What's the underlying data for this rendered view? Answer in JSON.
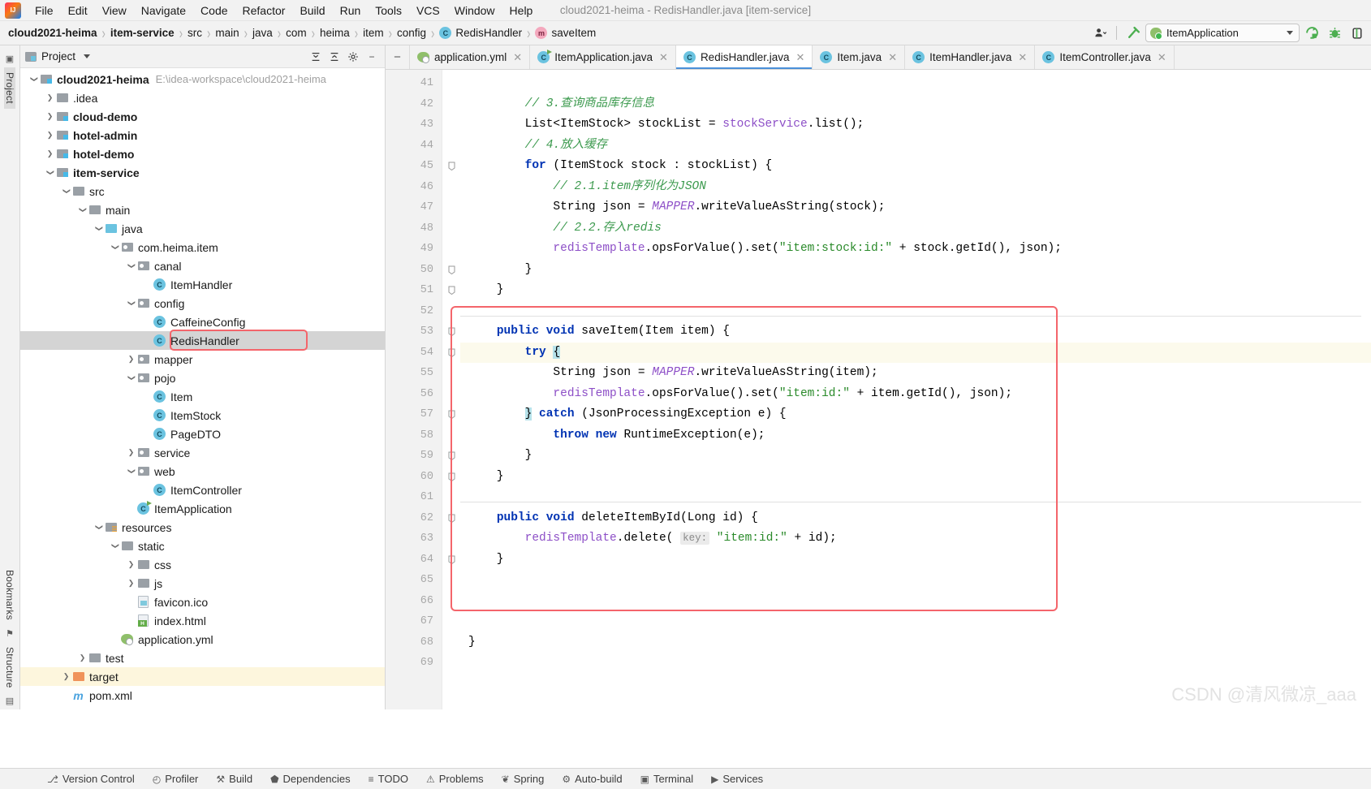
{
  "window": {
    "title": "cloud2021-heima - RedisHandler.java [item-service]"
  },
  "menubar": {
    "items": [
      {
        "label": "File"
      },
      {
        "label": "Edit"
      },
      {
        "label": "View"
      },
      {
        "label": "Navigate"
      },
      {
        "label": "Code"
      },
      {
        "label": "Refactor"
      },
      {
        "label": "Build"
      },
      {
        "label": "Run"
      },
      {
        "label": "Tools"
      },
      {
        "label": "VCS"
      },
      {
        "label": "Window"
      },
      {
        "label": "Help"
      }
    ]
  },
  "breadcrumb": {
    "items": [
      {
        "label": "cloud2021-heima",
        "bold": true
      },
      {
        "label": "item-service",
        "bold": true
      },
      {
        "label": "src"
      },
      {
        "label": "main"
      },
      {
        "label": "java"
      },
      {
        "label": "com"
      },
      {
        "label": "heima"
      },
      {
        "label": "item"
      },
      {
        "label": "config"
      },
      {
        "label": "RedisHandler",
        "badge": "C"
      },
      {
        "label": "saveItem",
        "badge": "m"
      }
    ]
  },
  "toolbar": {
    "run_config": "ItemApplication",
    "buttons": [
      "search-everywhere",
      "settings"
    ]
  },
  "rail": {
    "project_label": "Project",
    "bookmarks_label": "Bookmarks",
    "structure_label": "Structure"
  },
  "project_panel": {
    "title": "Project",
    "tree": [
      {
        "depth": 0,
        "arrow": "d",
        "icon": "f-mod",
        "label": "cloud2021-heima",
        "bold": true,
        "hint": "E:\\idea-workspace\\cloud2021-heima"
      },
      {
        "depth": 1,
        "arrow": "r",
        "icon": "f-plain",
        "label": ".idea"
      },
      {
        "depth": 1,
        "arrow": "r",
        "icon": "f-mod",
        "label": "cloud-demo",
        "bold": true
      },
      {
        "depth": 1,
        "arrow": "r",
        "icon": "f-mod",
        "label": "hotel-admin",
        "bold": true
      },
      {
        "depth": 1,
        "arrow": "r",
        "icon": "f-mod",
        "label": "hotel-demo",
        "bold": true
      },
      {
        "depth": 1,
        "arrow": "d",
        "icon": "f-mod",
        "label": "item-service",
        "bold": true
      },
      {
        "depth": 2,
        "arrow": "d",
        "icon": "f-plain",
        "label": "src"
      },
      {
        "depth": 3,
        "arrow": "d",
        "icon": "f-plain",
        "label": "main"
      },
      {
        "depth": 4,
        "arrow": "d",
        "icon": "f-src",
        "label": "java"
      },
      {
        "depth": 5,
        "arrow": "d",
        "icon": "f-pkg",
        "label": "com.heima.item"
      },
      {
        "depth": 6,
        "arrow": "d",
        "icon": "f-pkg",
        "label": "canal"
      },
      {
        "depth": 7,
        "arrow": "",
        "icon": "c-ico",
        "label": "ItemHandler"
      },
      {
        "depth": 6,
        "arrow": "d",
        "icon": "f-pkg",
        "label": "config"
      },
      {
        "depth": 7,
        "arrow": "",
        "icon": "c-ico",
        "label": "CaffeineConfig"
      },
      {
        "depth": 7,
        "arrow": "",
        "icon": "c-ico",
        "label": "RedisHandler",
        "selected": true,
        "boxed": true
      },
      {
        "depth": 6,
        "arrow": "r",
        "icon": "f-pkg",
        "label": "mapper"
      },
      {
        "depth": 6,
        "arrow": "d",
        "icon": "f-pkg",
        "label": "pojo"
      },
      {
        "depth": 7,
        "arrow": "",
        "icon": "c-ico",
        "label": "Item"
      },
      {
        "depth": 7,
        "arrow": "",
        "icon": "c-ico",
        "label": "ItemStock"
      },
      {
        "depth": 7,
        "arrow": "",
        "icon": "c-ico",
        "label": "PageDTO"
      },
      {
        "depth": 6,
        "arrow": "r",
        "icon": "f-pkg",
        "label": "service"
      },
      {
        "depth": 6,
        "arrow": "d",
        "icon": "f-pkg",
        "label": "web"
      },
      {
        "depth": 7,
        "arrow": "",
        "icon": "c-ico",
        "label": "ItemController"
      },
      {
        "depth": 6,
        "arrow": "",
        "icon": "c-boot",
        "label": "ItemApplication"
      },
      {
        "depth": 4,
        "arrow": "d",
        "icon": "f-res",
        "label": "resources"
      },
      {
        "depth": 5,
        "arrow": "d",
        "icon": "f-plain",
        "label": "static"
      },
      {
        "depth": 6,
        "arrow": "r",
        "icon": "f-plain",
        "label": "css"
      },
      {
        "depth": 6,
        "arrow": "r",
        "icon": "f-plain",
        "label": "js"
      },
      {
        "depth": 6,
        "arrow": "",
        "icon": "ico-img",
        "label": "favicon.ico"
      },
      {
        "depth": 6,
        "arrow": "",
        "icon": "ico-html",
        "label": "index.html"
      },
      {
        "depth": 5,
        "arrow": "",
        "icon": "yml",
        "label": "application.yml"
      },
      {
        "depth": 3,
        "arrow": "r",
        "icon": "f-plain",
        "label": "test"
      },
      {
        "depth": 2,
        "arrow": "r",
        "icon": "f-tgt",
        "label": "target",
        "yellow": true
      },
      {
        "depth": 2,
        "arrow": "",
        "icon": "mvn",
        "label": "pom.xml"
      }
    ]
  },
  "editor_tabs": [
    {
      "label": "application.yml",
      "icon": "yml",
      "active": false
    },
    {
      "label": "ItemApplication.java",
      "icon": "boot",
      "active": false
    },
    {
      "label": "RedisHandler.java",
      "icon": "class",
      "active": true
    },
    {
      "label": "Item.java",
      "icon": "class",
      "active": false
    },
    {
      "label": "ItemHandler.java",
      "icon": "class",
      "active": false
    },
    {
      "label": "ItemController.java",
      "icon": "class",
      "active": false
    }
  ],
  "code": {
    "first_line": 41,
    "last_line": 69,
    "highlight_line": 54,
    "lines": [
      {
        "n": 41,
        "fold": "",
        "text": ""
      },
      {
        "n": 42,
        "fold": "",
        "html": "        <span class='cmt'>// 3.查询商品库存信息</span>"
      },
      {
        "n": 43,
        "fold": "",
        "html": "        List&lt;ItemStock&gt; stockList = <span class='fld'>stockService</span>.list();"
      },
      {
        "n": 44,
        "fold": "",
        "html": "        <span class='cmt'>// 4.放入缓存</span>"
      },
      {
        "n": 45,
        "fold": "minus",
        "html": "        <span class='kw'>for</span> (ItemStock stock : stockList) {"
      },
      {
        "n": 46,
        "fold": "",
        "html": "            <span class='cmt'>// 2.1.item序列化为JSON</span>"
      },
      {
        "n": 47,
        "fold": "",
        "html": "            String json = <span class='sfld'>MAPPER</span>.writeValueAsString(stock);"
      },
      {
        "n": 48,
        "fold": "",
        "html": "            <span class='cmt'>// 2.2.存入redis</span>"
      },
      {
        "n": 49,
        "fold": "",
        "html": "            <span class='fld'>redisTemplate</span>.opsForValue().set(<span class='str'>\"item:stock:id:\"</span> + stock.getId(), json);"
      },
      {
        "n": 50,
        "fold": "minus",
        "html": "        }"
      },
      {
        "n": 51,
        "fold": "minus",
        "html": "    }"
      },
      {
        "n": 52,
        "fold": "",
        "html": ""
      },
      {
        "n": 53,
        "fold": "minus",
        "html": "    <span class='kw'>public</span> <span class='kw'>void</span> saveItem(Item item) {"
      },
      {
        "n": 54,
        "fold": "minus",
        "html": "        <span class='kw'>try</span> <span class='caretbg'>{</span>"
      },
      {
        "n": 55,
        "fold": "",
        "html": "            String json = <span class='sfld'>MAPPER</span>.writeValueAsString(item);"
      },
      {
        "n": 56,
        "fold": "",
        "html": "            <span class='fld'>redisTemplate</span>.opsForValue().set(<span class='str'>\"item:id:\"</span> + item.getId(), json);"
      },
      {
        "n": 57,
        "fold": "minus",
        "html": "        <span class='caretbg'>}</span> <span class='kw'>catch</span> (JsonProcessingException e) {"
      },
      {
        "n": 58,
        "fold": "",
        "html": "            <span class='kw'>throw</span> <span class='kw'>new</span> RuntimeException(e);"
      },
      {
        "n": 59,
        "fold": "minus",
        "html": "        }"
      },
      {
        "n": 60,
        "fold": "minus",
        "html": "    }"
      },
      {
        "n": 61,
        "fold": "",
        "html": ""
      },
      {
        "n": 62,
        "fold": "minus",
        "html": "    <span class='kw'>public</span> <span class='kw'>void</span> deleteItemById(Long id) {"
      },
      {
        "n": 63,
        "fold": "",
        "html": "        <span class='fld'>redisTemplate</span>.delete( <span class='hint'>key:</span> <span class='str'>\"item:id:\"</span> + id);"
      },
      {
        "n": 64,
        "fold": "minus",
        "html": "    }"
      },
      {
        "n": 65,
        "fold": "",
        "html": ""
      },
      {
        "n": 66,
        "fold": "",
        "html": ""
      },
      {
        "n": 67,
        "fold": "",
        "html": ""
      },
      {
        "n": 68,
        "fold": "",
        "html": "}"
      },
      {
        "n": 69,
        "fold": "",
        "html": ""
      }
    ]
  },
  "watermark": "CSDN @清风微凉_aaa",
  "statusbar": {
    "items": [
      {
        "label": "Version Control",
        "icon": "branch-icon"
      },
      {
        "label": "Profiler",
        "icon": "gauge-icon"
      },
      {
        "label": "Build",
        "icon": "hammer-icon"
      },
      {
        "label": "Dependencies",
        "icon": "deps-icon"
      },
      {
        "label": "TODO",
        "icon": "list-icon"
      },
      {
        "label": "Problems",
        "icon": "warning-icon"
      },
      {
        "label": "Spring",
        "icon": "leaf-icon"
      },
      {
        "label": "Auto-build",
        "icon": "autobuild-icon"
      },
      {
        "label": "Terminal",
        "icon": "terminal-icon"
      },
      {
        "label": "Services",
        "icon": "services-icon"
      }
    ]
  },
  "colors": {
    "accent_blue": "#4a90d9",
    "annotation_red": "#f4656b",
    "selection_gray": "#d4d4d4",
    "highlight_yellow": "#fdf6dd"
  }
}
